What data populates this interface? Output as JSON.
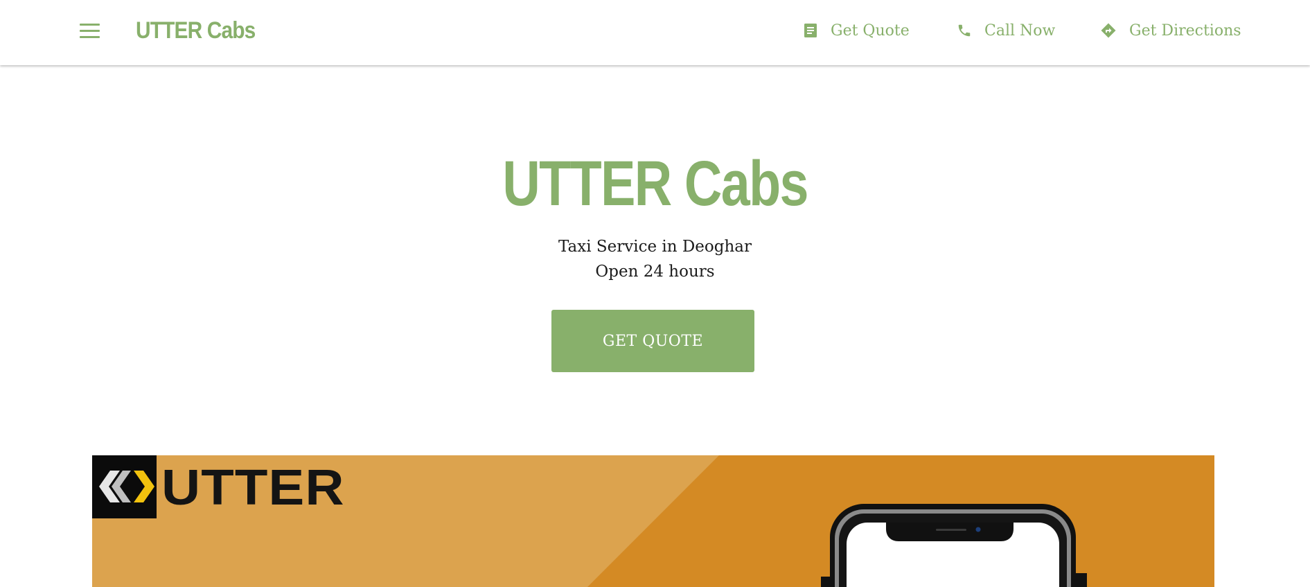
{
  "header": {
    "brand": "UTTER Cabs",
    "actions": [
      {
        "label": "Get Quote",
        "icon": "document-icon"
      },
      {
        "label": "Call Now",
        "icon": "phone-icon"
      },
      {
        "label": "Get Directions",
        "icon": "directions-icon"
      }
    ]
  },
  "hero": {
    "title": "UTTER Cabs",
    "subtitle_line1": "Taxi Service in Deoghar",
    "subtitle_line2": "Open 24 hours",
    "cta_label": "GET QUOTE"
  },
  "banner": {
    "logo_text": "UTTER"
  },
  "colors": {
    "accent": "#88b06b",
    "banner_light": "#dca34e",
    "banner_dark": "#d48a24",
    "text": "#1b1b1b"
  }
}
